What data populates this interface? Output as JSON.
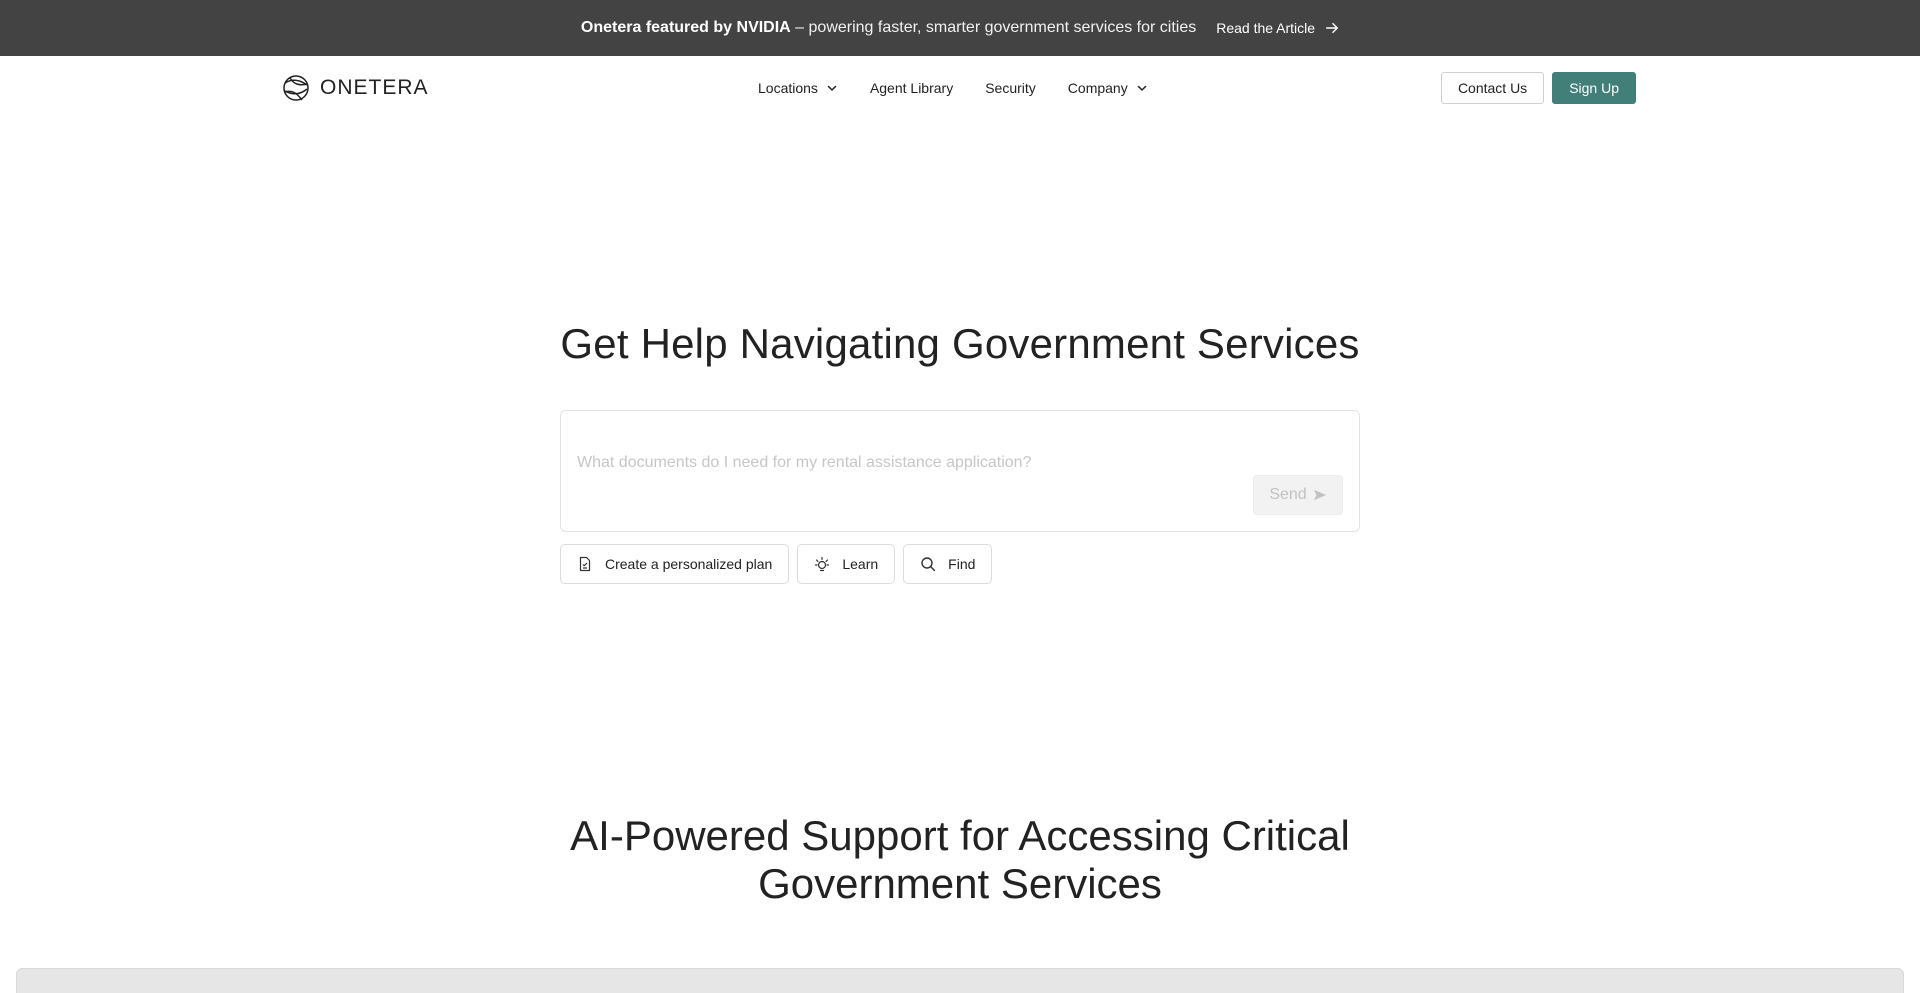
{
  "announcement": {
    "bold": "Onetera featured by NVIDIA",
    "rest": " – powering faster, smarter government services for cities",
    "link": "Read the Article"
  },
  "nav": {
    "brand": "ONETERA",
    "menu": [
      {
        "label": "Locations",
        "dropdown": true
      },
      {
        "label": "Agent Library",
        "dropdown": false
      },
      {
        "label": "Security",
        "dropdown": false
      },
      {
        "label": "Company",
        "dropdown": true
      }
    ],
    "contact": "Contact Us",
    "signup": "Sign Up"
  },
  "hero": {
    "title": "Get Help Navigating Government Services",
    "placeholder": "What documents do I need for my rental assistance application?",
    "send": "Send",
    "chips": [
      {
        "label": "Create a personalized plan",
        "icon": "document-icon"
      },
      {
        "label": "Learn",
        "icon": "lightbulb-icon"
      },
      {
        "label": "Find",
        "icon": "search-icon"
      }
    ]
  },
  "section": {
    "title_line1": "AI-Powered Support for Accessing Critical",
    "title_line2": "Government Services"
  },
  "colors": {
    "announcement_bg": "#434343",
    "primary": "#437f79"
  }
}
